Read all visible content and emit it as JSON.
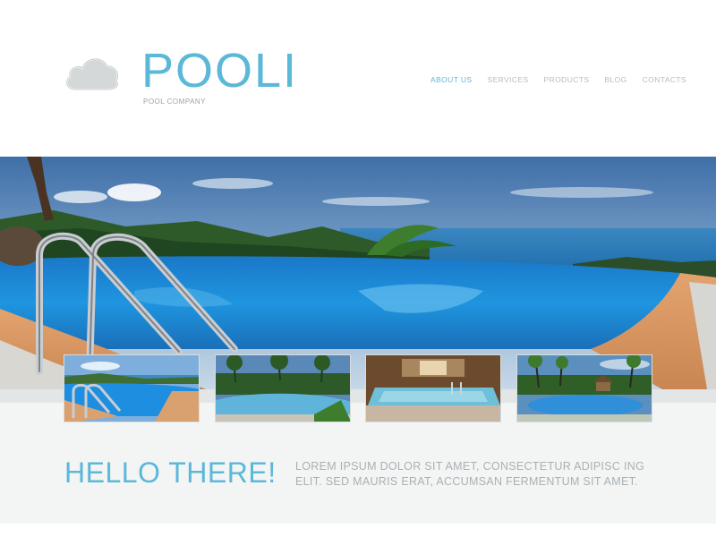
{
  "brand": {
    "name": "POOLI",
    "tagline": "POOL COMPANY",
    "logo_icon": "cloud-icon"
  },
  "nav": {
    "items": [
      {
        "label": "ABOUT US",
        "active": true
      },
      {
        "label": "SERVICES",
        "active": false
      },
      {
        "label": "PRODUCTS",
        "active": false
      },
      {
        "label": "BLOG",
        "active": false
      },
      {
        "label": "CONTACTS",
        "active": false
      }
    ]
  },
  "intro": {
    "heading": "HELLO THERE!",
    "text": "LOREM IPSUM DOLOR SIT AMET, CONSECTETUR ADIPISC ING ELIT. SED MAURIS ERAT, ACCUMSAN FERMENTUM SIT AMET."
  },
  "colors": {
    "accent": "#5bb8d8",
    "nav_inactive": "#b4bcbf",
    "band": "#f3f5f5"
  }
}
